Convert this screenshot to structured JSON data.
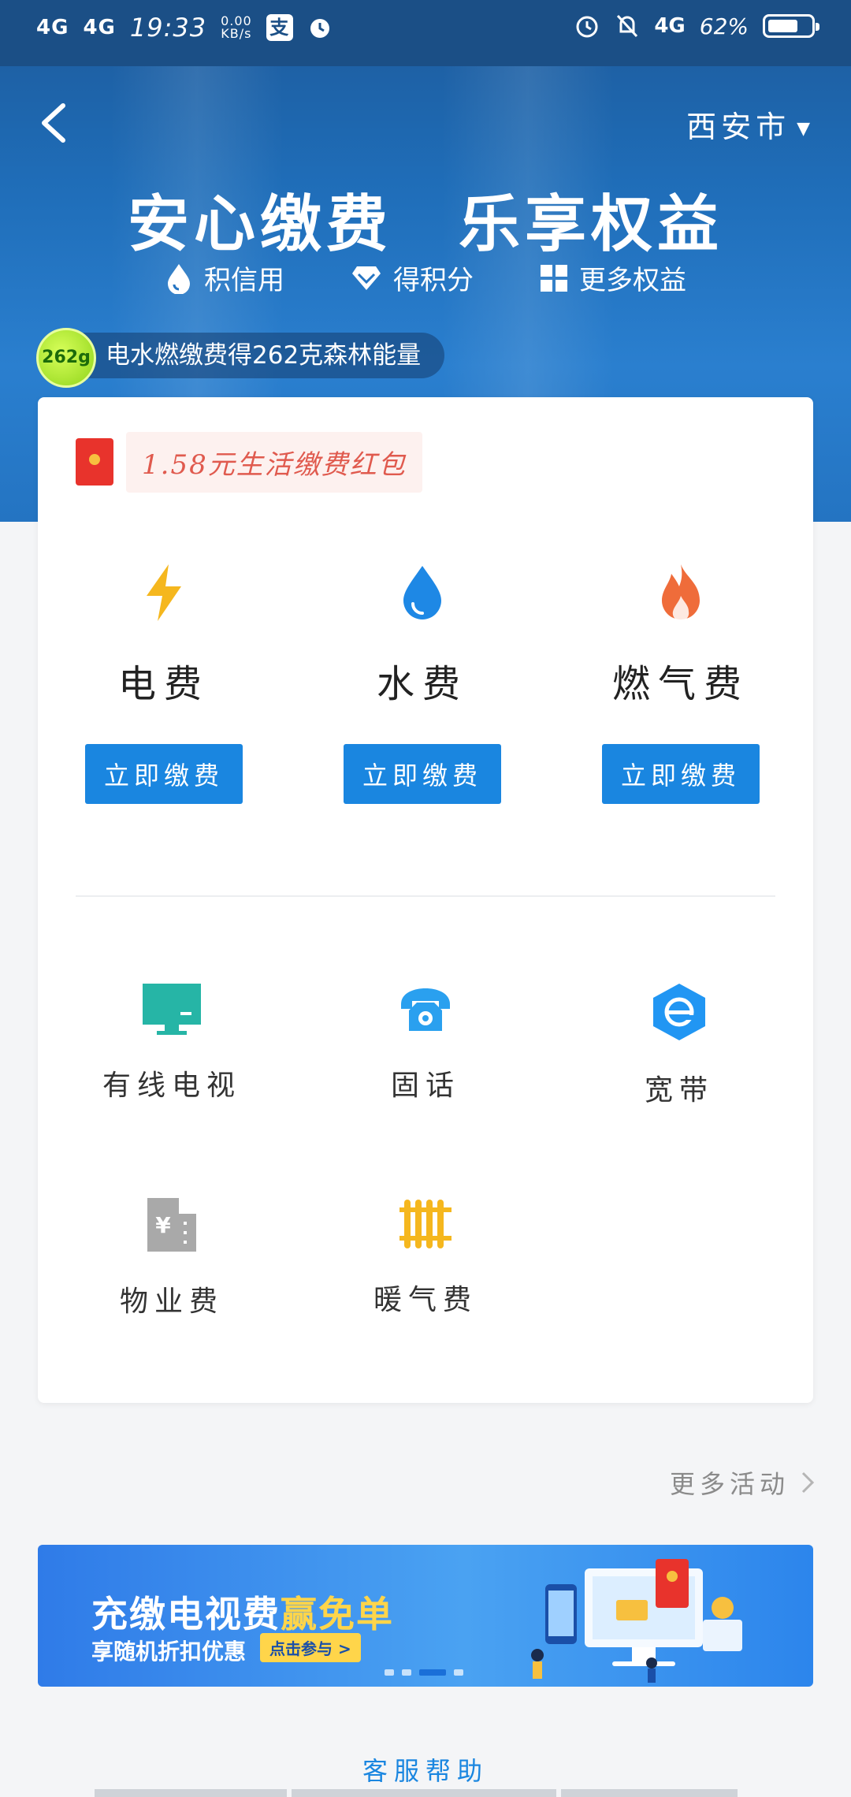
{
  "status_bar": {
    "signal_1": "4G",
    "signal_2": "4G",
    "time": "19:33",
    "speed_value": "0.00",
    "speed_unit": "KB/s",
    "alipay_badge": "支",
    "net_right": "4G",
    "battery": "62%"
  },
  "header": {
    "city": "西安市",
    "city_arrow": "▼",
    "slogan": "安心缴费　乐享权益",
    "benefits": [
      "积信用",
      "得积分",
      "更多权益"
    ]
  },
  "energy": {
    "badge": "262g",
    "text": "电水燃缴费得262克森林能量"
  },
  "red_packet": {
    "text": "1.58元生活缴费红包"
  },
  "utilities": [
    {
      "name": "电费",
      "button": "立即缴费"
    },
    {
      "name": "水费",
      "button": "立即缴费"
    },
    {
      "name": "燃气费",
      "button": "立即缴费"
    }
  ],
  "services": [
    {
      "name": "有线电视"
    },
    {
      "name": "固话"
    },
    {
      "name": "宽带"
    },
    {
      "name": "物业费"
    },
    {
      "name": "暖气费"
    }
  ],
  "more_activities": "更多活动",
  "banner": {
    "title_part1": "充缴电视费",
    "title_part2": "赢免单",
    "subtitle": "享随机折扣优惠",
    "cta": "点击参与 >"
  },
  "help": "客服帮助",
  "colors": {
    "primary": "#1a86e0",
    "electric": "#f5b71e",
    "water": "#1e88e5",
    "gas": "#ef6c3a",
    "tv": "#26b5a6",
    "phone": "#2aa0ef",
    "broadband": "#2196f3",
    "property": "#a9a9a9",
    "heating": "#f5b71e"
  }
}
